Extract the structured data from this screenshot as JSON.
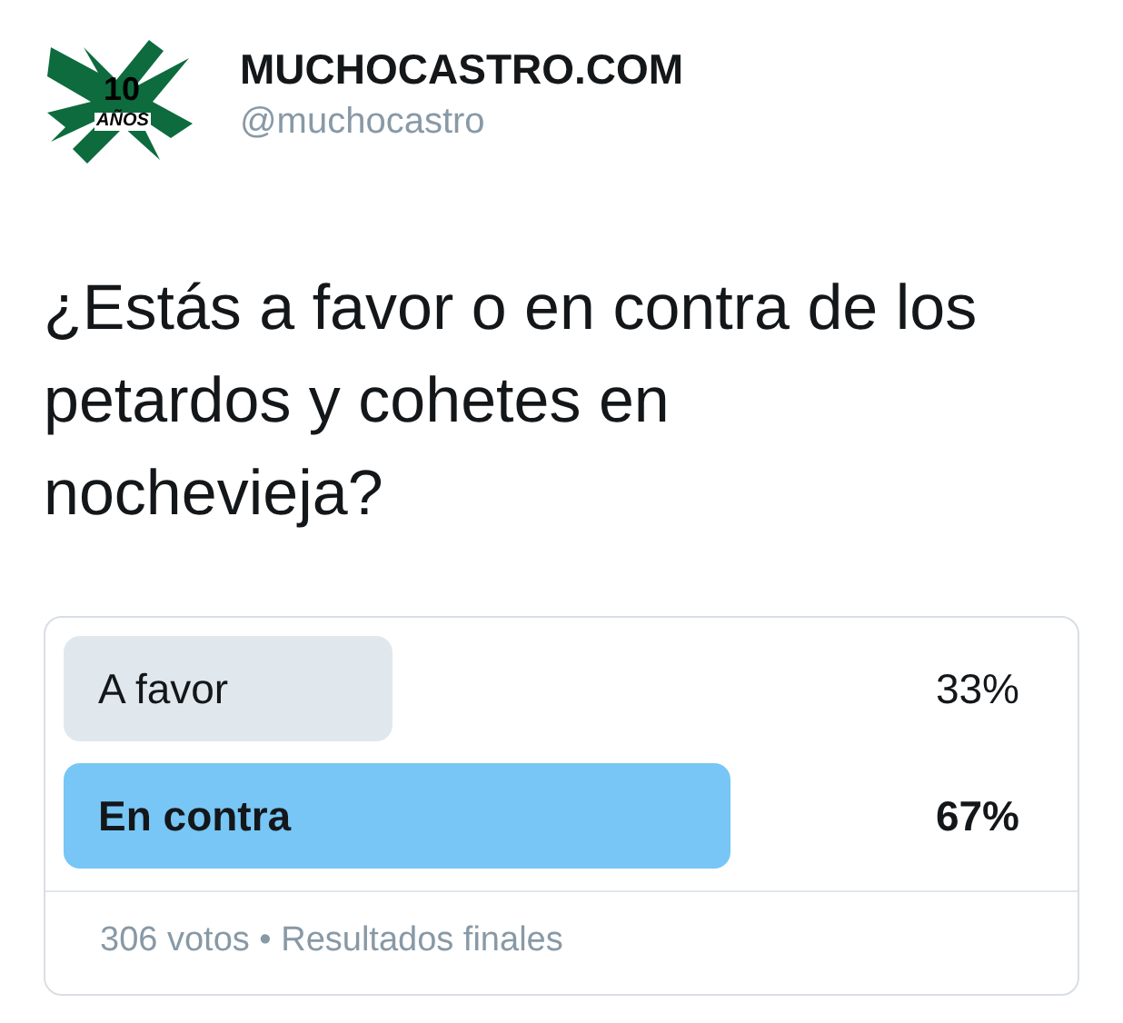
{
  "account": {
    "logo_text": [
      "10",
      "AÑOS"
    ],
    "name": "MUCHOCASTRO.COM",
    "handle": "@muchocastro"
  },
  "question": "¿Estás a favor o en contra de los petardos y cohetes en nochevieja?",
  "poll": {
    "options": [
      {
        "label": "A favor",
        "percent": "33%",
        "winner": false
      },
      {
        "label": "En contra",
        "percent": "67%",
        "winner": true
      }
    ],
    "footer": "306 votos • Resultados finales"
  }
}
